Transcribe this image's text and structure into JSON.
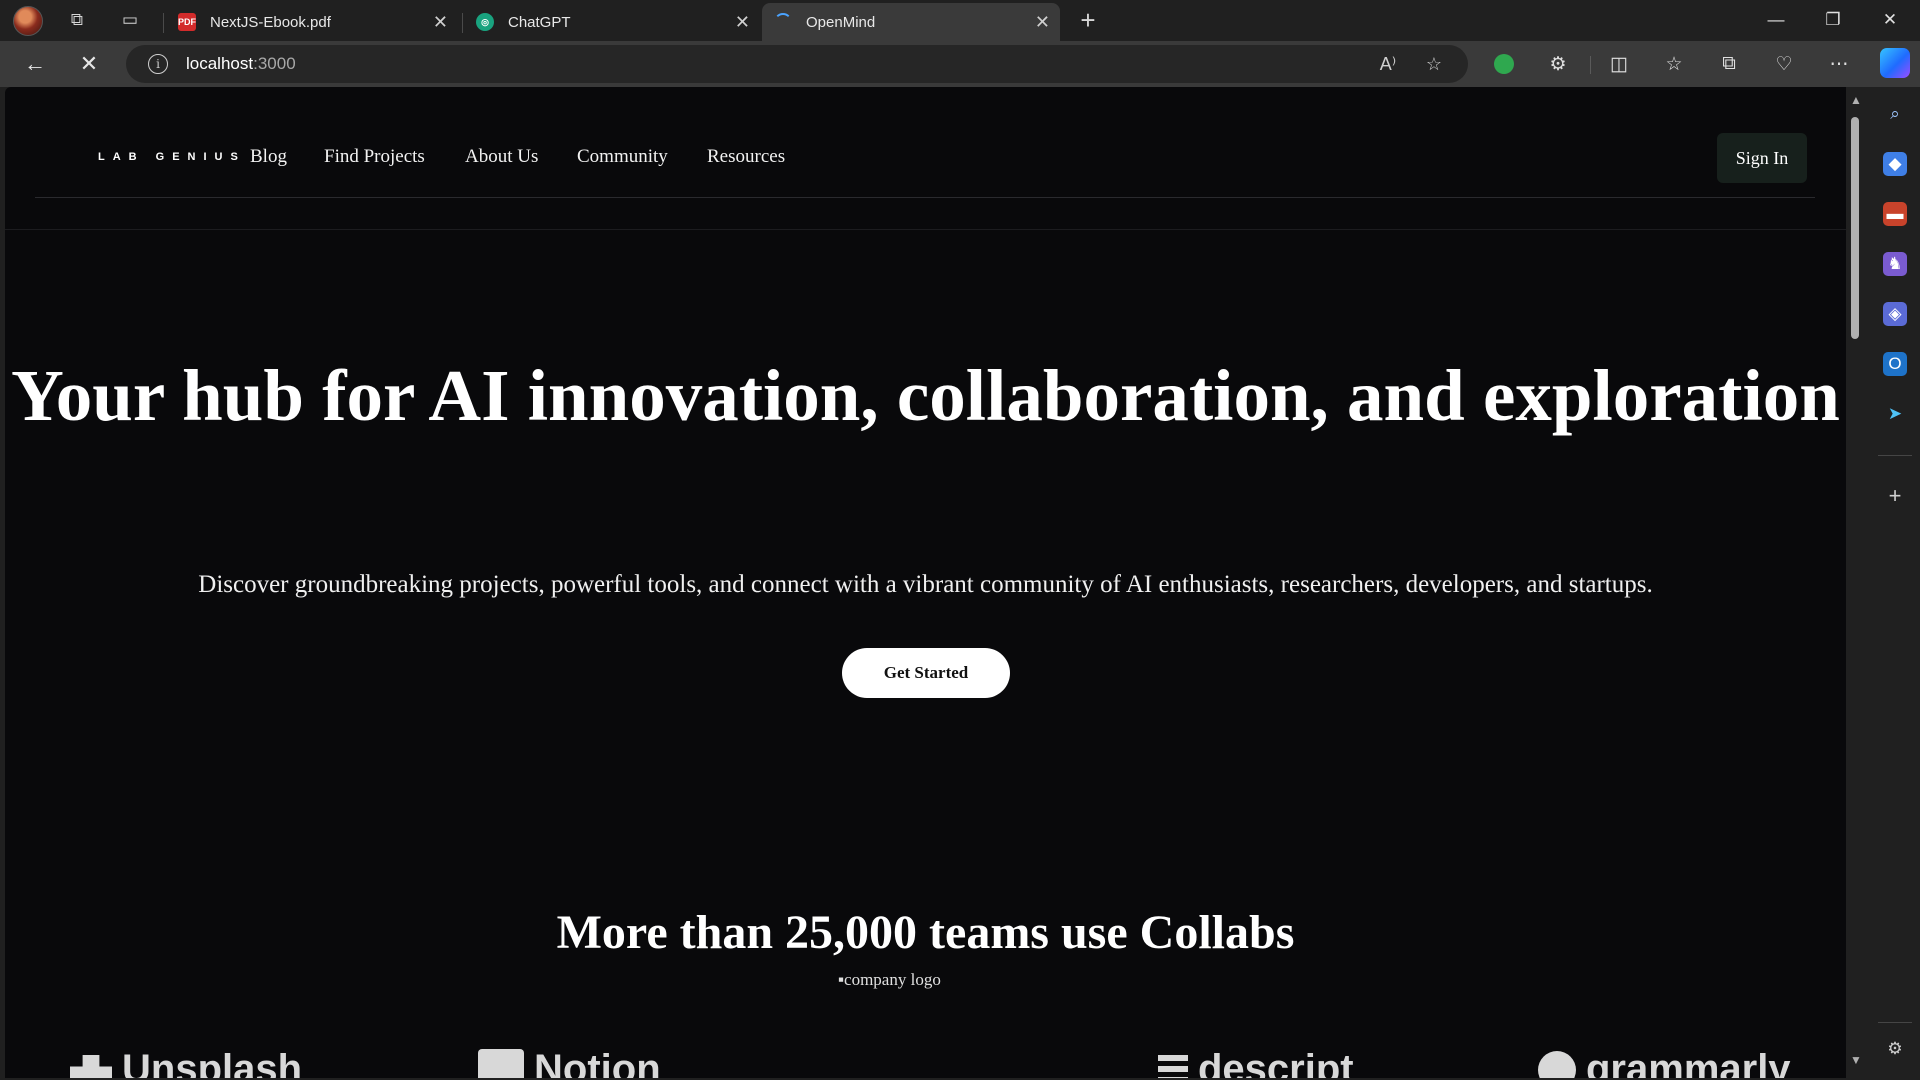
{
  "browser": {
    "tabs": [
      {
        "title": "NextJS-Ebook.pdf",
        "favicon": "pdf-icon",
        "active": false
      },
      {
        "title": "ChatGPT",
        "favicon": "chatgpt-icon",
        "active": false
      },
      {
        "title": "OpenMind",
        "favicon": "loading-icon",
        "active": true
      }
    ],
    "url_host": "localhost",
    "url_port": ":3000"
  },
  "site": {
    "logo": "LAB GENIUS",
    "nav": [
      "Blog",
      "Find Projects",
      "About Us",
      "Community",
      "Resources"
    ],
    "signin_label": "Sign In",
    "hero_title": "Your hub for AI innovation, collaboration, and exploration",
    "hero_subtitle": "Discover groundbreaking projects, powerful tools, and connect with a vibrant community of AI enthusiasts, researchers, developers, and startups.",
    "cta_label": "Get Started",
    "teams_title": "More than 25,000 teams use Collabs",
    "company_logos": [
      "Unsplash",
      "Notion",
      "company logo",
      "descript",
      "grammarly"
    ]
  },
  "colors": {
    "page_bg": "#09090b",
    "chrome_bg": "#202020",
    "toolbar_bg": "#3a3a3a",
    "signin_bg": "#17201c"
  }
}
